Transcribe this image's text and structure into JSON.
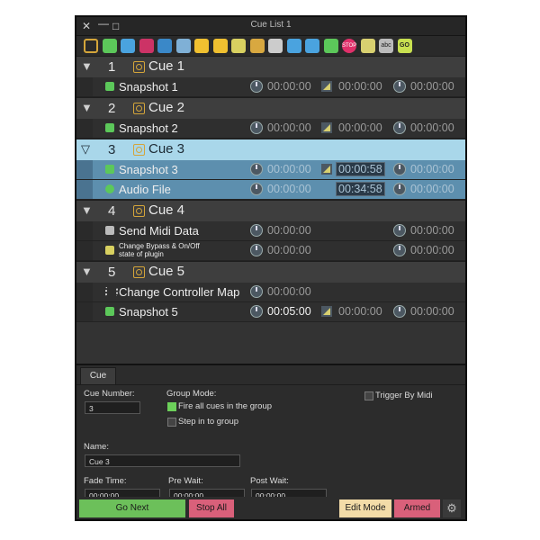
{
  "window": {
    "title": "Cue List 1",
    "close": "✕",
    "minimize": "—",
    "maximize": "□"
  },
  "toolbar": {
    "tools": [
      {
        "icon": "cue-icon",
        "color": "#d4a53a"
      },
      {
        "icon": "snapshot-icon",
        "color": "#5cc85a"
      },
      {
        "icon": "camera-icon",
        "color": "#4aa3df"
      },
      {
        "icon": "no-snapshot-icon",
        "color": "#c36"
      },
      {
        "icon": "globe-icon",
        "color": "#3a88c8"
      },
      {
        "icon": "midi-icon",
        "color": "#7fb0d6"
      },
      {
        "icon": "curve-icon",
        "color": "#f0c030"
      },
      {
        "icon": "plugin-icon",
        "color": "#f0c030"
      },
      {
        "icon": "bypass-icon",
        "color": "#d8d060"
      },
      {
        "icon": "automation-icon",
        "color": "#d8a840"
      },
      {
        "icon": "controller-map-icon",
        "color": "#cccccc"
      },
      {
        "icon": "layers-icon",
        "color": "#4aa3df"
      },
      {
        "icon": "mixer-icon",
        "color": "#4aa3df"
      },
      {
        "icon": "waveform-icon",
        "color": "#5cc85a"
      },
      {
        "icon": "stop-icon",
        "color": "#e0306a"
      },
      {
        "icon": "fade-icon",
        "color": "#d8d070"
      },
      {
        "icon": "text-icon",
        "color": "#bbbbbb"
      },
      {
        "icon": "go-icon",
        "color": "#c8e050"
      }
    ],
    "labels": {
      "stop": "STOP",
      "abc": "abc",
      "go": "GO"
    }
  },
  "cues": [
    {
      "number": "1",
      "name": "Cue 1",
      "selected": false,
      "children": [
        {
          "name": "Snapshot 1",
          "icon": "snapshot-icon",
          "t1": "00:00:00",
          "t2": "00:00:00",
          "t3": "00:00:00"
        }
      ]
    },
    {
      "number": "2",
      "name": "Cue 2",
      "selected": false,
      "children": [
        {
          "name": "Snapshot 2",
          "icon": "snapshot-icon",
          "t1": "00:00:00",
          "t2": "00:00:00",
          "t3": "00:00:00"
        }
      ]
    },
    {
      "number": "3",
      "name": "Cue 3",
      "selected": true,
      "children": [
        {
          "name": "Snapshot 3",
          "icon": "snapshot-icon",
          "t1": "00:00:00",
          "t2": "00:00:58",
          "t3": "00:00:00"
        },
        {
          "name": "Audio File",
          "icon": "audio-icon",
          "t1": "00:00:00",
          "t2": "00:34:58",
          "t3": "00:00:00"
        }
      ]
    },
    {
      "number": "4",
      "name": "Cue 4",
      "selected": false,
      "children": [
        {
          "name": "Send Midi Data",
          "icon": "midi-icon",
          "t1": "00:00:00",
          "t3": "00:00:00"
        },
        {
          "name": "Change Bypass & On/Off state of plugin",
          "icon": "bypass-icon",
          "t1": "00:00:00",
          "t3": "00:00:00"
        }
      ]
    },
    {
      "number": "5",
      "name": "Cue 5",
      "selected": false,
      "children": [
        {
          "name": "Change Controller Map",
          "icon": "controller-map-icon",
          "t1": "00:00:00"
        },
        {
          "name": "Snapshot 5",
          "icon": "snapshot-icon",
          "t1": "00:05:00",
          "t2": "00:00:00",
          "t3": "00:00:00"
        }
      ]
    }
  ],
  "panel": {
    "tab": "Cue",
    "cue_number_label": "Cue Number:",
    "cue_number_value": "3",
    "group_mode_label": "Group Mode:",
    "fire_all_label": "Fire all cues in the group",
    "step_in_label": "Step in to group",
    "trigger_by_midi_label": "Trigger By Midi",
    "name_label": "Name:",
    "name_value": "Cue 3",
    "fade_time_label": "Fade Time:",
    "fade_time_value": "00:00:00",
    "pre_wait_label": "Pre Wait:",
    "pre_wait_value": "00:00:00",
    "post_wait_label": "Post Wait:",
    "post_wait_value": "00:00:00"
  },
  "buttons": {
    "go_next": "Go Next",
    "stop_all": "Stop All",
    "edit_mode": "Edit Mode",
    "armed": "Armed",
    "colors": {
      "go_next": "#6cc05a",
      "stop_all": "#d9607a",
      "edit_mode": "#f3dca8",
      "armed": "#d9607a"
    }
  }
}
